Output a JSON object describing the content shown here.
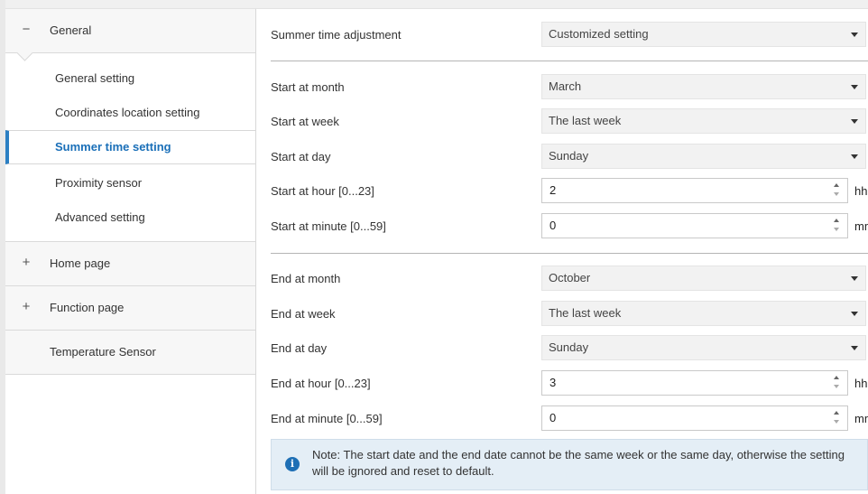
{
  "sidebar": {
    "general": {
      "toggle": "−",
      "label": "General"
    },
    "general_items": [
      {
        "label": "General setting"
      },
      {
        "label": "Coordinates location setting"
      },
      {
        "label": "Summer time setting"
      },
      {
        "label": "Proximity sensor"
      },
      {
        "label": "Advanced setting"
      }
    ],
    "home_page": {
      "toggle": "+",
      "label": "Home page"
    },
    "function_page": {
      "toggle": "+",
      "label": "Function page"
    },
    "temperature_sensor": {
      "label": "Temperature Sensor"
    }
  },
  "main": {
    "summer": {
      "label": "Summer time adjustment",
      "value": "Customized setting"
    },
    "start_month": {
      "label": "Start at month",
      "value": "March"
    },
    "start_week": {
      "label": "Start at week",
      "value": "The last week"
    },
    "start_day": {
      "label": "Start at day",
      "value": "Sunday"
    },
    "start_hour": {
      "label": "Start at hour [0...23]",
      "value": "2",
      "unit": "hh"
    },
    "start_minute": {
      "label": "Start at minute [0...59]",
      "value": "0",
      "unit": "mm"
    },
    "end_month": {
      "label": "End at month",
      "value": "October"
    },
    "end_week": {
      "label": "End at week",
      "value": "The last week"
    },
    "end_day": {
      "label": "End at day",
      "value": "Sunday"
    },
    "end_hour": {
      "label": "End at hour [0...23]",
      "value": "3",
      "unit": "hh"
    },
    "end_minute": {
      "label": "End at minute [0...59]",
      "value": "0",
      "unit": "mm"
    },
    "note": "Note: The start date and the end date cannot be the same week or the same day, otherwise the setting will be ignored and reset to default."
  },
  "colors": {
    "accent": "#2c7fc3",
    "active_text": "#1a6fb8",
    "note_bg": "#e4eef6",
    "info_icon": "#1e6fb5"
  }
}
